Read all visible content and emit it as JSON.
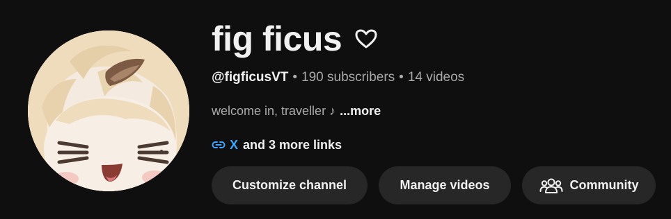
{
  "channel": {
    "name": "fig ficus",
    "handle": "@figficusVT",
    "subscribers": "190 subscribers",
    "videos": "14 videos",
    "separator": "•",
    "description": "welcome in, traveller ♪",
    "more_label": "...more"
  },
  "links": {
    "primary": "X",
    "more": "and 3 more links"
  },
  "buttons": {
    "customize": "Customize channel",
    "manage": "Manage videos",
    "community": "Community"
  },
  "icons": {
    "heart": "heart-outline-icon",
    "link": "link-icon",
    "community": "people-icon"
  },
  "colors": {
    "background": "#0f0f0f",
    "text": "#f1f1f1",
    "muted": "#aaaaaa",
    "link": "#3ea6ff",
    "button": "#272727"
  }
}
